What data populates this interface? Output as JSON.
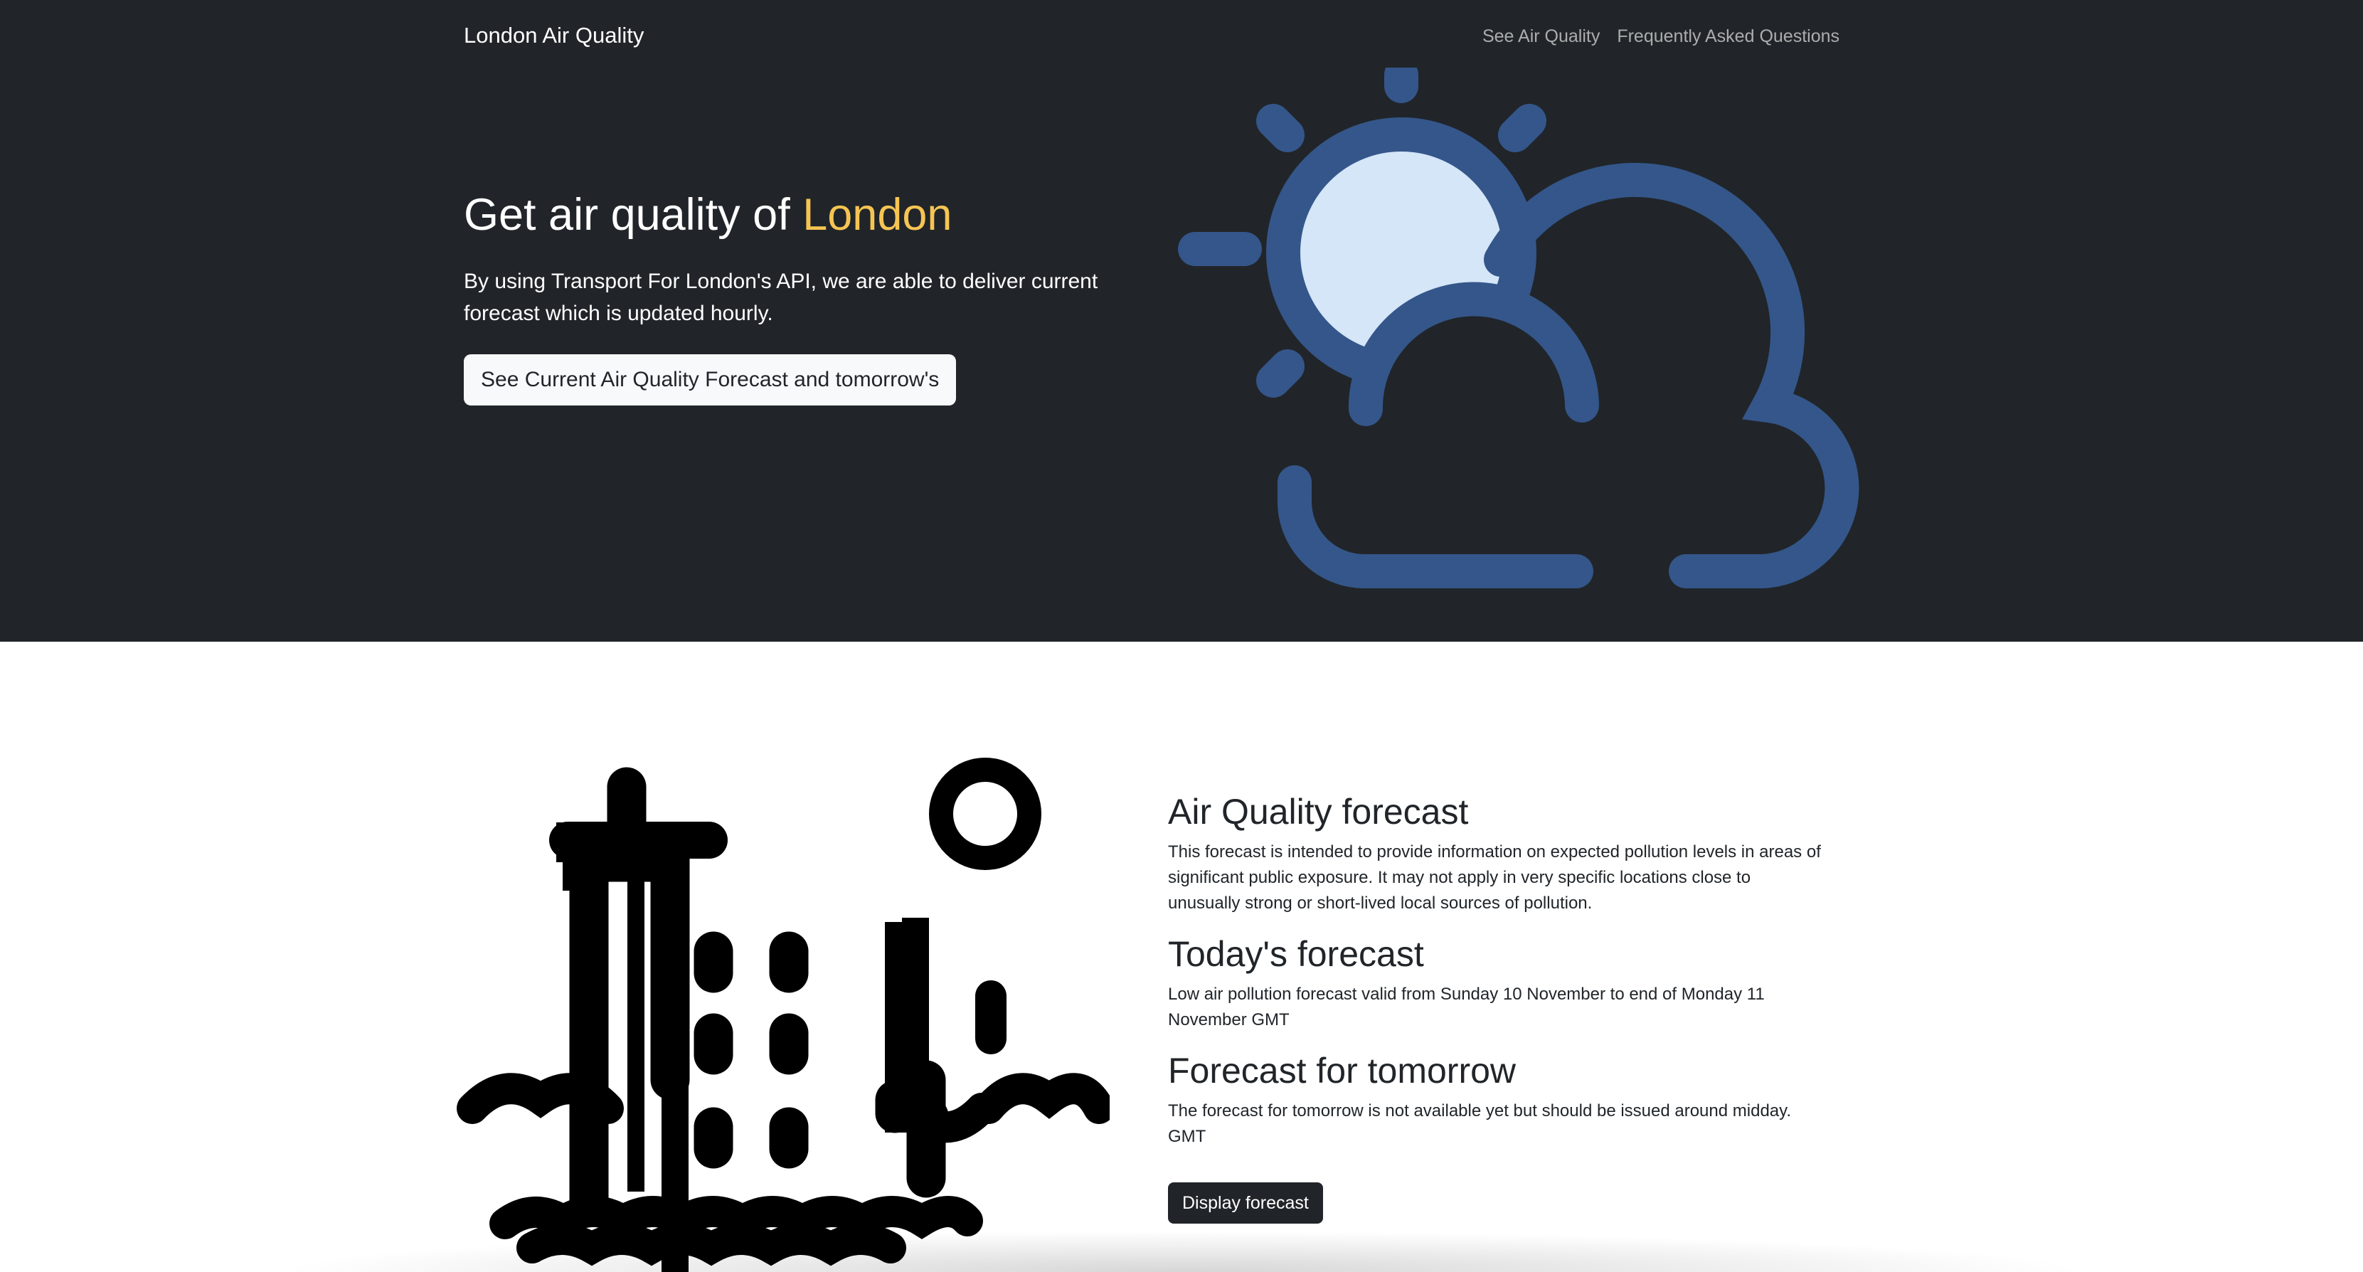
{
  "navbar": {
    "brand": "London Air Quality",
    "links": [
      "See Air Quality",
      "Frequently Asked Questions"
    ]
  },
  "hero": {
    "title_prefix": "Get air quality of ",
    "title_highlight": "London",
    "description": "By using Transport For London's API, we are able to deliver current forecast which is updated hourly.",
    "button_label": "See Current Air Quality Forecast and tomorrow's",
    "illustration": "sun-behind-cloud-icon"
  },
  "forecast": {
    "illustration": "city-buildings-smog-icon",
    "sections": [
      {
        "heading": "Air Quality forecast",
        "body": "This forecast is intended to provide information on expected pollution levels in areas of significant public exposure. It may not apply in very specific locations close to unusually strong or short-lived local sources of pollution."
      },
      {
        "heading": "Today's forecast",
        "body": "Low air pollution forecast valid from Sunday 10 November to end of Monday 11 November GMT"
      },
      {
        "heading": "Forecast for tomorrow",
        "body": "The forecast for tomorrow is not available yet but should be issued around midday. GMT"
      }
    ],
    "button_label": "Display forecast"
  },
  "colors": {
    "dark_background": "#212529",
    "accent": "#f6c453",
    "icon_blue": "#34568a",
    "sun_fill": "#d4e6f7"
  }
}
